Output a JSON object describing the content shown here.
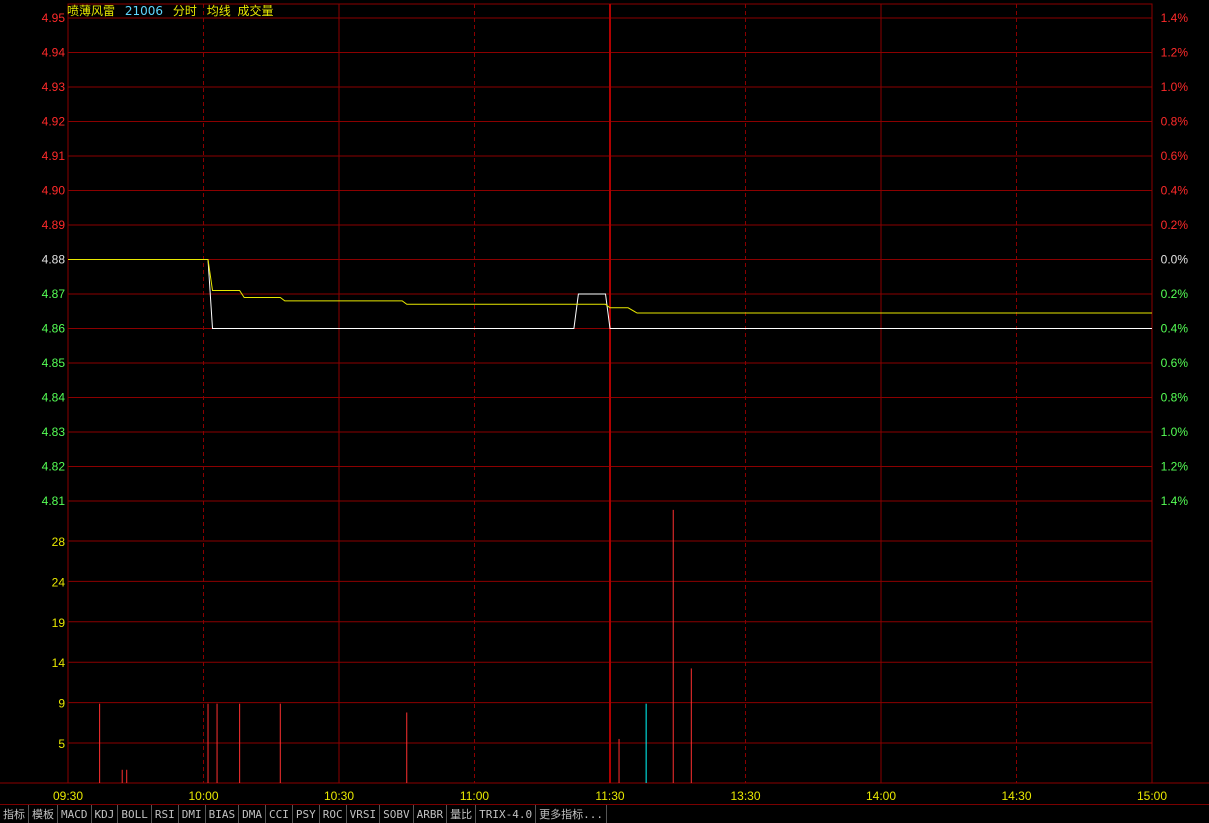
{
  "header": {
    "stock_name": "喷薄风雷",
    "code": "21006",
    "labels": [
      "分时",
      "均线",
      "成交量"
    ]
  },
  "colors": {
    "grid": "#8b0000",
    "axis_up": "#ff2a2a",
    "axis_flat": "#e0e0e0",
    "axis_down": "#55ff55",
    "volume_axis": "#e8e800",
    "time_axis": "#e8e800",
    "price_line": "#ffffff",
    "avg_line": "#e8e800",
    "volume_bar": "#ff3030",
    "volume_bar_alt": "#00ffff",
    "header_name": "#e8e800",
    "header_code": "#5fd7ff",
    "header_label": "#e8e800"
  },
  "time_axis": [
    "09:30",
    "10:00",
    "10:30",
    "11:00",
    "11:30",
    "13:30",
    "14:00",
    "14:30",
    "15:00"
  ],
  "tabs": [
    "指标",
    "模板",
    "MACD",
    "KDJ",
    "BOLL",
    "RSI",
    "DMI",
    "BIAS",
    "DMA",
    "CCI",
    "PSY",
    "ROC",
    "VRSI",
    "SOBV",
    "ARBR",
    "量比",
    "TRIX-4.0",
    "更多指标..."
  ],
  "chart_data": {
    "type": "line",
    "reference_price": 4.88,
    "price_ticks": [
      "4.95",
      "4.94",
      "4.93",
      "4.92",
      "4.91",
      "4.90",
      "4.89",
      "4.88",
      "4.87",
      "4.86",
      "4.85",
      "4.84",
      "4.83",
      "4.82",
      "4.81"
    ],
    "percent_ticks": [
      "1.4%",
      "1.2%",
      "1.0%",
      "0.8%",
      "0.6%",
      "0.4%",
      "0.2%",
      "0.0%",
      "0.2%",
      "0.4%",
      "0.6%",
      "0.8%",
      "1.0%",
      "1.2%",
      "1.4%"
    ],
    "volume_ticks": [
      "28",
      "24",
      "19",
      "14",
      "9",
      "5"
    ],
    "ylim": [
      4.81,
      4.95
    ],
    "volume_ylim": [
      0,
      32
    ],
    "x_minutes": [
      0,
      240
    ],
    "series": [
      {
        "name": "分时",
        "points": [
          [
            0,
            4.88
          ],
          [
            31,
            4.88
          ],
          [
            32,
            4.86
          ],
          [
            112,
            4.86
          ],
          [
            113,
            4.87
          ],
          [
            119,
            4.87
          ],
          [
            120,
            4.86
          ],
          [
            240,
            4.86
          ]
        ]
      },
      {
        "name": "均线",
        "points": [
          [
            0,
            4.88
          ],
          [
            31,
            4.88
          ],
          [
            32,
            4.871
          ],
          [
            38,
            4.871
          ],
          [
            39,
            4.869
          ],
          [
            47,
            4.869
          ],
          [
            48,
            4.868
          ],
          [
            74,
            4.868
          ],
          [
            75,
            4.867
          ],
          [
            119,
            4.867
          ],
          [
            120,
            4.866
          ],
          [
            124,
            4.866
          ],
          [
            126,
            4.8645
          ],
          [
            240,
            4.8645
          ]
        ]
      }
    ],
    "volume": [
      {
        "t": 7,
        "v": 9
      },
      {
        "t": 12,
        "v": 1.5
      },
      {
        "t": 13,
        "v": 1.5
      },
      {
        "t": 31,
        "v": 9
      },
      {
        "t": 33,
        "v": 9
      },
      {
        "t": 38,
        "v": 9
      },
      {
        "t": 47,
        "v": 9
      },
      {
        "t": 75,
        "v": 8
      },
      {
        "t": 122,
        "v": 5
      },
      {
        "t": 128,
        "v": 9,
        "alt": true
      },
      {
        "t": 134,
        "v": 31
      },
      {
        "t": 138,
        "v": 13
      }
    ]
  }
}
